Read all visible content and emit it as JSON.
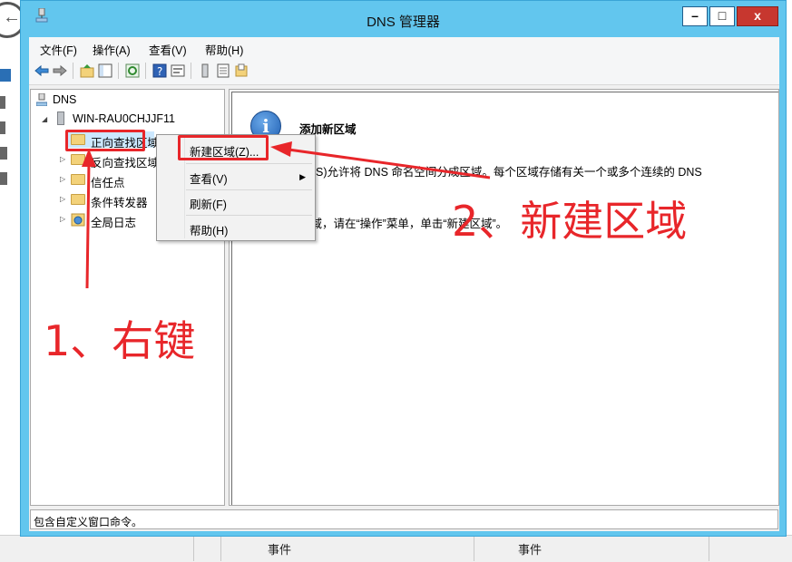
{
  "window": {
    "title": "DNS 管理器"
  },
  "window_buttons": {
    "minimize": "–",
    "maximize": "□",
    "close": "x"
  },
  "menubar": {
    "items": [
      "文件(F)",
      "操作(A)",
      "查看(V)",
      "帮助(H)"
    ]
  },
  "toolbar": {
    "icons": [
      "back-icon",
      "forward-icon",
      "up-folder-icon",
      "show-tree-icon",
      "refresh-icon",
      "help-icon",
      "properties-icon",
      "server-icon",
      "list-icon",
      "export-icon"
    ]
  },
  "tree": {
    "root": "DNS",
    "server": "WIN-RAU0CHJJF11",
    "items": [
      "正向查找区域",
      "反向查找区域",
      "信任点",
      "条件转发器",
      "全局日志"
    ]
  },
  "right_pane": {
    "title": "添加新区域",
    "desc1": "DNS)允许将 DNS 命名空间分成区域。每个区域存储有关一个或多个连续的 DNS",
    "desc2": "区域，请在“操作”菜单，单击“新建区域”。"
  },
  "context_menu": {
    "items": [
      "新建区域(Z)...",
      "查看(V)",
      "刷新(F)",
      "帮助(H)"
    ]
  },
  "statusbar": {
    "text": "包含自定义窗口命令。"
  },
  "annotations": {
    "step1": "1、右键",
    "step2": "2、新建区域",
    "color": "#e8262a"
  },
  "background": {
    "event_label_1": "事件",
    "event_label_2": "事件"
  }
}
